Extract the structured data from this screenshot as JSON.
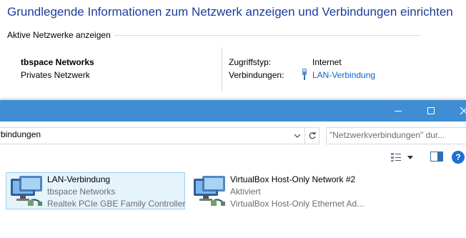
{
  "network_center": {
    "title": "Grundlegende Informationen zum Netzwerk anzeigen und Verbindungen einrichten",
    "active_networks_heading": "Aktive Netzwerke anzeigen",
    "network": {
      "name": "tbspace Networks",
      "type": "Privates Netzwerk",
      "access_type_label": "Zugriffstyp:",
      "access_type_value": "Internet",
      "connections_label": "Verbindungen:",
      "connections_link": "LAN-Verbindung"
    }
  },
  "window": {
    "titlebar_color": "#3f8ed3",
    "address": "rbindungen",
    "search_placeholder": "\"Netzwerkverbindungen\" dur...",
    "connections": [
      {
        "name": "LAN-Verbindung",
        "line2": "tbspace Networks",
        "line3": "Realtek PCIe GBE Family Controller",
        "selected": true
      },
      {
        "name": "VirtualBox Host-Only Network #2",
        "line2": "Aktiviert",
        "line3": "VirtualBox Host-Only Ethernet Ad...",
        "selected": false
      }
    ]
  }
}
